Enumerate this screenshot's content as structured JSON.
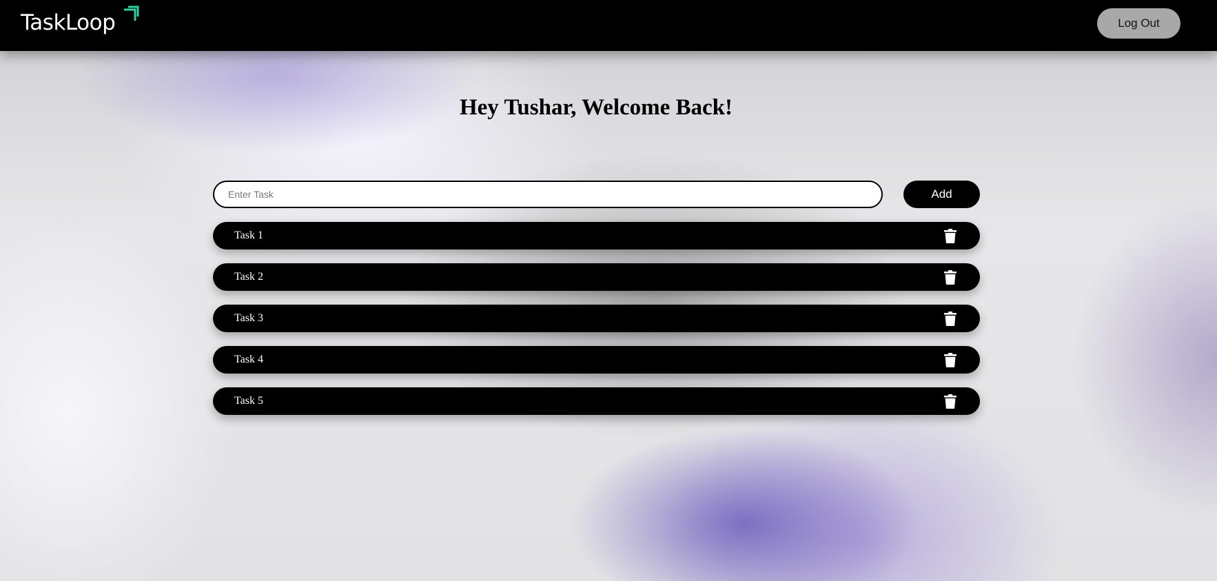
{
  "brand": {
    "name": "TaskLoop",
    "accent": "#2bd1a0"
  },
  "header": {
    "logout_label": "Log Out"
  },
  "greeting": "Hey Tushar, Welcome Back!",
  "task_form": {
    "placeholder": "Enter Task",
    "value": "",
    "add_label": "Add"
  },
  "tasks": [
    {
      "label": "Task 1",
      "icon": "trash-icon"
    },
    {
      "label": "Task 2",
      "icon": "trash-icon"
    },
    {
      "label": "Task 3",
      "icon": "trash-icon"
    },
    {
      "label": "Task 4",
      "icon": "trash-icon"
    },
    {
      "label": "Task 5",
      "icon": "trash-icon"
    }
  ]
}
